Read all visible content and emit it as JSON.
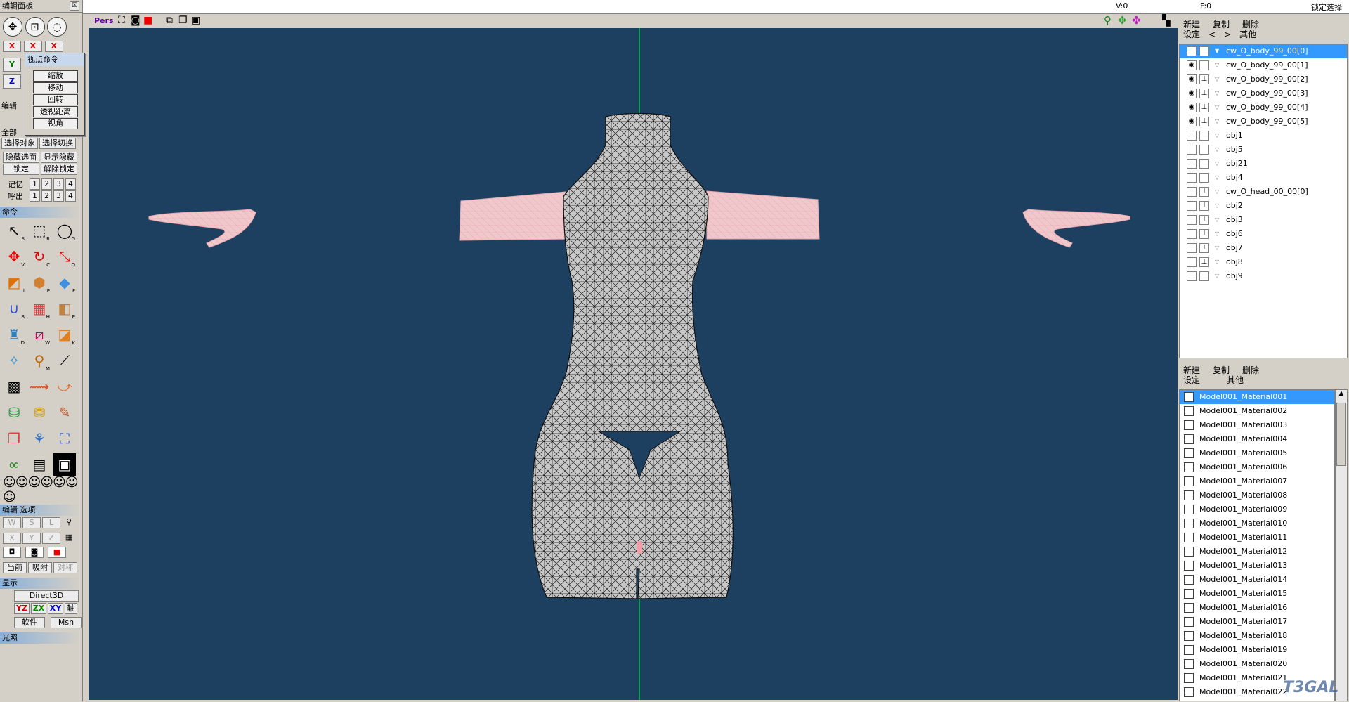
{
  "edit_panel": {
    "title": "编辑面板",
    "close": "☒"
  },
  "axis": {
    "x": "X",
    "y": "Y",
    "z": "Z"
  },
  "view_popup": {
    "title": "视点命令",
    "items": [
      "缩放",
      "移动",
      "回转",
      "透视距离",
      "视角"
    ]
  },
  "left_labels": {
    "edit": "编辑",
    "all": "全部",
    "select": "选择对象",
    "invert": "选择切换",
    "hide": "隐藏选面",
    "show": "显示隐藏",
    "lock": "锁定",
    "unlock": "解除锁定",
    "memory": "记忆",
    "recall": "呼出",
    "nums": [
      "1",
      "2",
      "3",
      "4"
    ]
  },
  "command_section": "命令",
  "tool_keys": [
    "S",
    "R",
    "G",
    "V",
    "C",
    "Q",
    "I",
    "P",
    "F",
    "B",
    "H",
    "E",
    "D",
    "W",
    "K",
    "",
    "M",
    "",
    "",
    "",
    "",
    "",
    "",
    "",
    "",
    "",
    ""
  ],
  "edit_options": {
    "title": "编辑 选项",
    "wsl": [
      "W",
      "S",
      "L"
    ],
    "xyz": [
      "X",
      "Y",
      "Z"
    ],
    "current": "当前",
    "snap": "吸附",
    "symmetry": "对称"
  },
  "display": {
    "title": "显示",
    "renderer": "Direct3D",
    "planes": [
      "YZ",
      "ZX",
      "XY"
    ],
    "axis": "轴",
    "software": "软件",
    "msh": "Msh"
  },
  "light_section": "光照",
  "viewport": {
    "mode": "Pers"
  },
  "status": {
    "v": "V:0",
    "f": "F:0",
    "lock_select": "锁定选择"
  },
  "objects_panel": {
    "new": "新建",
    "copy": "复制",
    "delete": "删除",
    "settings": "设定",
    "prev": "<",
    "next": ">",
    "other": "其他"
  },
  "objects": [
    {
      "name": "cw_O_body_99_00[0]",
      "eye": true,
      "lock": true,
      "selected": true,
      "expand": "▼"
    },
    {
      "name": "cw_O_body_99_00[1]",
      "eye": true,
      "lock": false,
      "selected": false,
      "expand": "▽"
    },
    {
      "name": "cw_O_body_99_00[2]",
      "eye": true,
      "lock": true,
      "selected": false,
      "expand": "▽"
    },
    {
      "name": "cw_O_body_99_00[3]",
      "eye": true,
      "lock": true,
      "selected": false,
      "expand": "▽"
    },
    {
      "name": "cw_O_body_99_00[4]",
      "eye": true,
      "lock": true,
      "selected": false,
      "expand": "▽"
    },
    {
      "name": "cw_O_body_99_00[5]",
      "eye": true,
      "lock": true,
      "selected": false,
      "expand": "▽"
    },
    {
      "name": "obj1",
      "eye": false,
      "lock": false,
      "selected": false,
      "expand": "▽"
    },
    {
      "name": "obj5",
      "eye": false,
      "lock": false,
      "selected": false,
      "expand": "▽"
    },
    {
      "name": "obj21",
      "eye": false,
      "lock": false,
      "selected": false,
      "expand": "▽"
    },
    {
      "name": "obj4",
      "eye": false,
      "lock": false,
      "selected": false,
      "expand": "▽"
    },
    {
      "name": "cw_O_head_00_00[0]",
      "eye": false,
      "lock": true,
      "selected": false,
      "expand": "▽"
    },
    {
      "name": "obj2",
      "eye": false,
      "lock": true,
      "selected": false,
      "expand": "▽"
    },
    {
      "name": "obj3",
      "eye": false,
      "lock": true,
      "selected": false,
      "expand": "▽"
    },
    {
      "name": "obj6",
      "eye": false,
      "lock": true,
      "selected": false,
      "expand": "▽"
    },
    {
      "name": "obj7",
      "eye": false,
      "lock": true,
      "selected": false,
      "expand": "▽"
    },
    {
      "name": "obj8",
      "eye": false,
      "lock": true,
      "selected": false,
      "expand": "▽"
    },
    {
      "name": "obj9",
      "eye": false,
      "lock": false,
      "selected": false,
      "expand": "▽"
    }
  ],
  "materials_panel": {
    "new": "新建",
    "copy": "复制",
    "delete": "删除",
    "settings": "设定",
    "other": "其他"
  },
  "materials": [
    "Model001_Material001",
    "Model001_Material002",
    "Model001_Material003",
    "Model001_Material004",
    "Model001_Material005",
    "Model001_Material006",
    "Model001_Material007",
    "Model001_Material008",
    "Model001_Material009",
    "Model001_Material010",
    "Model001_Material011",
    "Model001_Material012",
    "Model001_Material013",
    "Model001_Material014",
    "Model001_Material015",
    "Model001_Material016",
    "Model001_Material017",
    "Model001_Material018",
    "Model001_Material019",
    "Model001_Material020",
    "Model001_Material021",
    "Model001_Material022"
  ],
  "watermark": "T3GAL",
  "colors": {
    "viewport_bg": "#1e4060",
    "selected": "#3399ff",
    "mesh": "#c8c8c8",
    "skin": "#f0c8c8",
    "axis_green": "#00c040"
  }
}
